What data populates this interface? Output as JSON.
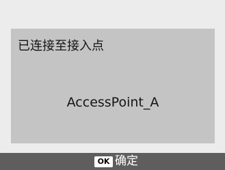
{
  "dialog": {
    "title": "已连接至接入点",
    "access_point_name": "AccessPoint_A"
  },
  "footer": {
    "ok_key_label": "OK",
    "ok_action_label": "确定"
  },
  "colors": {
    "screen_background": "#ececec",
    "dialog_background": "#c4c4c4",
    "footer_background": "#5e5e5e",
    "ok_key_background": "#ffffff",
    "text_dark": "#141414",
    "text_light": "#ffffff"
  }
}
